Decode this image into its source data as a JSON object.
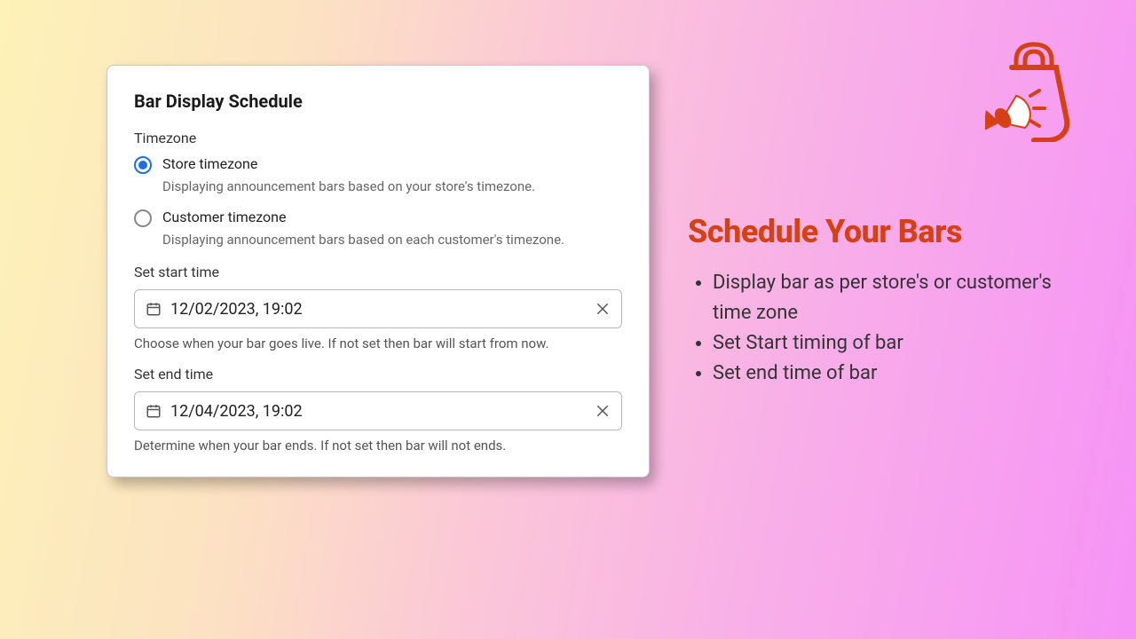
{
  "card": {
    "title": "Bar Display Schedule",
    "timezone_label": "Timezone",
    "store": {
      "label": "Store timezone",
      "desc": "Displaying announcement bars based on your store's timezone."
    },
    "customer": {
      "label": "Customer timezone",
      "desc": "Displaying announcement bars based on each customer's timezone."
    },
    "start": {
      "label": "Set start time",
      "value": "12/02/2023, 19:02",
      "help": "Choose when your bar goes live. If not set then bar will start from now."
    },
    "end": {
      "label": "Set end time",
      "value": "12/04/2023, 19:02",
      "help": "Determine when your bar ends. If not set then bar will not ends."
    }
  },
  "marketing": {
    "heading": "Schedule Your Bars",
    "bullets": [
      "Display bar as per store's or customer's time zone",
      "Set Start timing of bar",
      "Set end time of bar"
    ]
  }
}
